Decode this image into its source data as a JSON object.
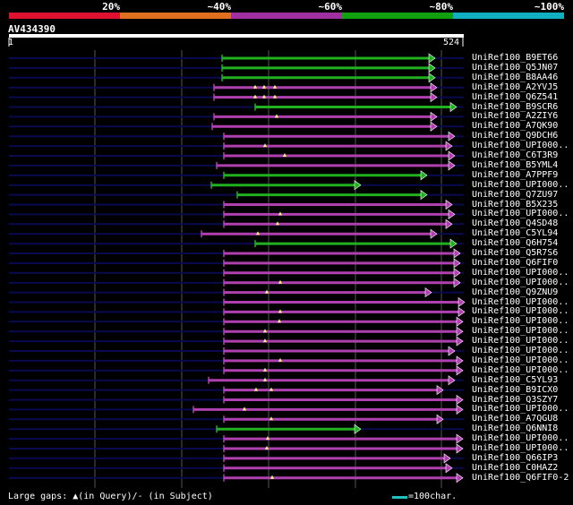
{
  "query": {
    "title": "AV434390",
    "start": "1",
    "end": "524"
  },
  "scale": {
    "labels": [
      "20%",
      "~40%",
      "~60%",
      "~80%",
      "~100%"
    ],
    "colors": [
      "#e01030",
      "#e07020",
      "#a030a0",
      "#10a010",
      "#10b0c0"
    ]
  },
  "colors": {
    "purple": "#b040b0",
    "green": "#20b020",
    "cyan": "#20c0c0",
    "navy": "#0a0a50"
  },
  "footer": {
    "gaps_text": "Large gaps: ▲(in Query)/- (in Subject)",
    "scale_text": "=100char."
  },
  "hits": [
    {
      "label": "UniRef100_B9ET66",
      "color": "green"
    },
    {
      "label": "UniRef100_Q5JN07",
      "color": "green"
    },
    {
      "label": "UniRef100_B8AA46",
      "color": "green"
    },
    {
      "label": "UniRef100_A2YVJ5",
      "color": "purple"
    },
    {
      "label": "UniRef100_Q6Z541",
      "color": "purple"
    },
    {
      "label": "UniRef100_B9SCR6",
      "color": "green"
    },
    {
      "label": "UniRef100_A2ZIY6",
      "color": "purple"
    },
    {
      "label": "UniRef100_A7QK90",
      "color": "purple"
    },
    {
      "label": "UniRef100_Q9DCH6",
      "color": "purple"
    },
    {
      "label": "UniRef100_UPI000..",
      "color": "purple"
    },
    {
      "label": "UniRef100_C6T3R9",
      "color": "purple"
    },
    {
      "label": "UniRef100_B5YML4",
      "color": "purple"
    },
    {
      "label": "UniRef100_A7PPF9",
      "color": "green"
    },
    {
      "label": "UniRef100_UPI000..",
      "color": "green"
    },
    {
      "label": "UniRef100_Q7ZU97",
      "color": "green"
    },
    {
      "label": "UniRef100_B5X235",
      "color": "purple"
    },
    {
      "label": "UniRef100_UPI000..",
      "color": "purple"
    },
    {
      "label": "UniRef100_Q4SD48",
      "color": "purple"
    },
    {
      "label": "UniRef100_C5YL94",
      "color": "purple"
    },
    {
      "label": "UniRef100_Q6H754",
      "color": "green"
    },
    {
      "label": "UniRef100_Q5R7S6",
      "color": "purple"
    },
    {
      "label": "UniRef100_Q6FIF0",
      "color": "purple"
    },
    {
      "label": "UniRef100_UPI000..",
      "color": "purple"
    },
    {
      "label": "UniRef100_UPI000..",
      "color": "purple"
    },
    {
      "label": "UniRef100_Q9ZNU9",
      "color": "purple"
    },
    {
      "label": "UniRef100_UPI000..",
      "color": "purple"
    },
    {
      "label": "UniRef100_UPI000..",
      "color": "purple"
    },
    {
      "label": "UniRef100_UPI000..",
      "color": "purple"
    },
    {
      "label": "UniRef100_UPI000..",
      "color": "purple"
    },
    {
      "label": "UniRef100_UPI000..",
      "color": "purple"
    },
    {
      "label": "UniRef100_UPI000..",
      "color": "purple"
    },
    {
      "label": "UniRef100_UPI000..",
      "color": "purple"
    },
    {
      "label": "UniRef100_UPI000..",
      "color": "purple"
    },
    {
      "label": "UniRef100_C5YL93",
      "color": "purple"
    },
    {
      "label": "UniRef100_B9ICX0",
      "color": "purple"
    },
    {
      "label": "UniRef100_Q3SZY7",
      "color": "purple"
    },
    {
      "label": "UniRef100_UPI000..",
      "color": "purple"
    },
    {
      "label": "UniRef100_A7QGU8",
      "color": "purple"
    },
    {
      "label": "UniRef100_Q6NNI8",
      "color": "green"
    },
    {
      "label": "UniRef100_UPI000..",
      "color": "purple"
    },
    {
      "label": "UniRef100_UPI000..",
      "color": "purple"
    },
    {
      "label": "UniRef100_Q66IP3",
      "color": "purple"
    },
    {
      "label": "UniRef100_C0HAZ2",
      "color": "purple"
    },
    {
      "label": "UniRef100_Q6FIF0-2",
      "color": "purple"
    }
  ]
}
